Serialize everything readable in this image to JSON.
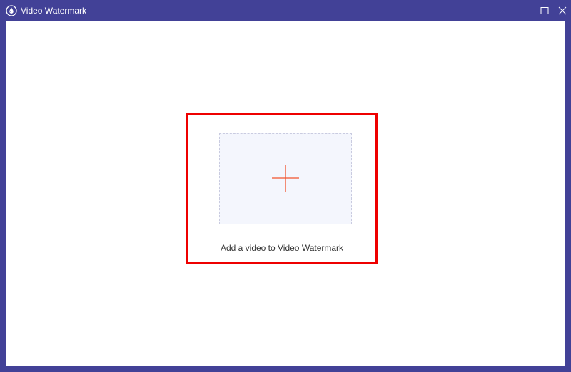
{
  "window": {
    "title": "Video Watermark",
    "app_icon": "water-drop-icon",
    "controls": {
      "minimize_icon": "minimize-icon",
      "maximize_icon": "maximize-icon",
      "close_icon": "close-icon"
    }
  },
  "main": {
    "add_prompt": "Add a video to Video Watermark",
    "add_icon": "plus-icon"
  },
  "colors": {
    "titlebar": "#424197",
    "content_bg": "#ffffff",
    "highlight": "#ee0000",
    "drop_zone_bg": "#f4f6fd",
    "drop_zone_border": "#c9cbe0",
    "accent_plus": "#f2542d"
  }
}
